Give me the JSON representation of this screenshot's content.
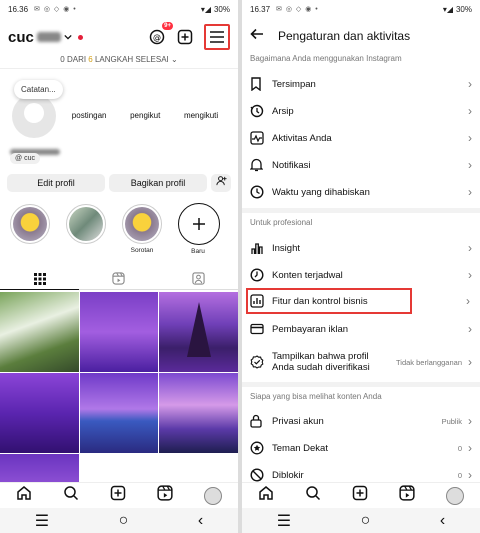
{
  "left": {
    "status_time": "16.36",
    "battery": "30%",
    "username": "cuc",
    "notif_badge": "9+",
    "progress_prefix": "0 DARI ",
    "progress_num": "6",
    "progress_suffix": " LANGKAH SELESAI",
    "note": "Catatan...",
    "stats": [
      {
        "num": "",
        "label": "postingan"
      },
      {
        "num": "",
        "label": "pengikut"
      },
      {
        "num": "",
        "label": "mengikuti"
      }
    ],
    "link": "cuc",
    "edit_profile": "Edit profil",
    "share_profile": "Bagikan profil",
    "highlights": [
      "",
      "",
      "Sorotan",
      "Baru"
    ]
  },
  "right": {
    "status_time": "16.37",
    "battery": "30%",
    "title": "Pengaturan dan aktivitas",
    "section1": "Bagaimana Anda menggunakan Instagram",
    "items1": [
      "Tersimpan",
      "Arsip",
      "Aktivitas Anda",
      "Notifikasi",
      "Waktu yang dihabiskan"
    ],
    "section2": "Untuk profesional",
    "items2": [
      "Insight",
      "Konten terjadwal",
      "Fitur dan kontrol bisnis",
      "Pembayaran iklan"
    ],
    "verified_label_1": "Tampilkan bahwa profil",
    "verified_label_2": "Anda sudah diverifikasi",
    "verified_value": "Tidak berlangganan",
    "section3": "Siapa yang bisa melihat konten Anda",
    "privacy_label": "Privasi akun",
    "privacy_value": "Publik",
    "close_friends_label": "Teman Dekat",
    "close_friends_value": "0",
    "blocked_label": "Diblokir",
    "blocked_value": "0"
  },
  "colors": {
    "highlight": "#e53935",
    "badge": "#ff3040"
  }
}
